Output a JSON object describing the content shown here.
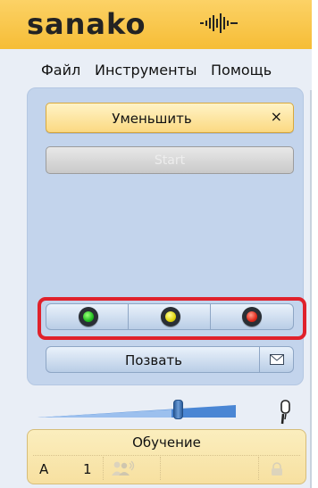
{
  "app": {
    "logo": "sanako"
  },
  "menu": {
    "items": [
      "Файл",
      "Инструменты",
      "Помощь"
    ]
  },
  "buttons": {
    "shrink_label": "Уменьшить",
    "close_glyph": "×",
    "start_label": "Start",
    "call_label": "Позвать"
  },
  "signals": [
    {
      "name": "green",
      "color": "#1fbf1f"
    },
    {
      "name": "yellow",
      "color": "#e0d50e"
    },
    {
      "name": "red",
      "color": "#e02a1b"
    }
  ],
  "status": {
    "title": "Обучение",
    "row": "A",
    "number": "1"
  },
  "volume": {
    "level": 0.7
  },
  "icons": {
    "logo_wave": "sound-wave-icon",
    "close": "close-icon",
    "message": "envelope-icon",
    "microphone": "microphone-icon",
    "users": "users-icon",
    "lock": "lock-icon"
  },
  "colors": {
    "header": "#f6bd36",
    "panel": "#c3d4ec",
    "highlight_border": "#e0212b",
    "status_bg": "#fbeebe"
  }
}
